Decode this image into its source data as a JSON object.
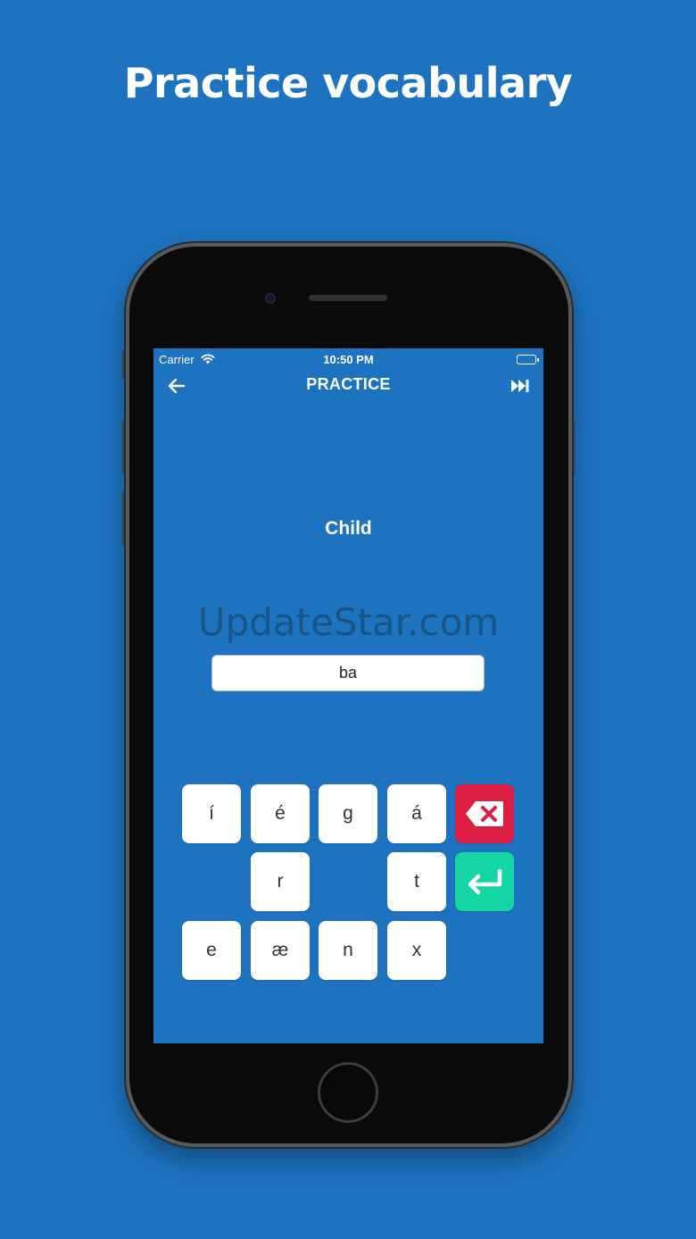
{
  "headline": "Practice vocabulary",
  "status_bar": {
    "carrier": "Carrier",
    "time": "10:50 PM",
    "battery_color": "#4cd964"
  },
  "nav": {
    "back_icon": "arrow-left-icon",
    "title": "PRACTICE",
    "skip_icon": "skip-forward-icon"
  },
  "prompt_word": "Child",
  "watermark": "UpdateStar.com",
  "answer_value": "ba",
  "keyboard": {
    "row1": [
      "í",
      "é",
      "g",
      "á"
    ],
    "row2": [
      "r",
      "t"
    ],
    "row3": [
      "e",
      "æ",
      "n",
      "x"
    ],
    "delete_icon": "backspace-icon",
    "delete_color": "#dd1d41",
    "enter_icon": "return-arrow-icon",
    "enter_color": "#14d6a3"
  },
  "colors": {
    "background": "#1d73bf",
    "key": "#ffffff"
  }
}
